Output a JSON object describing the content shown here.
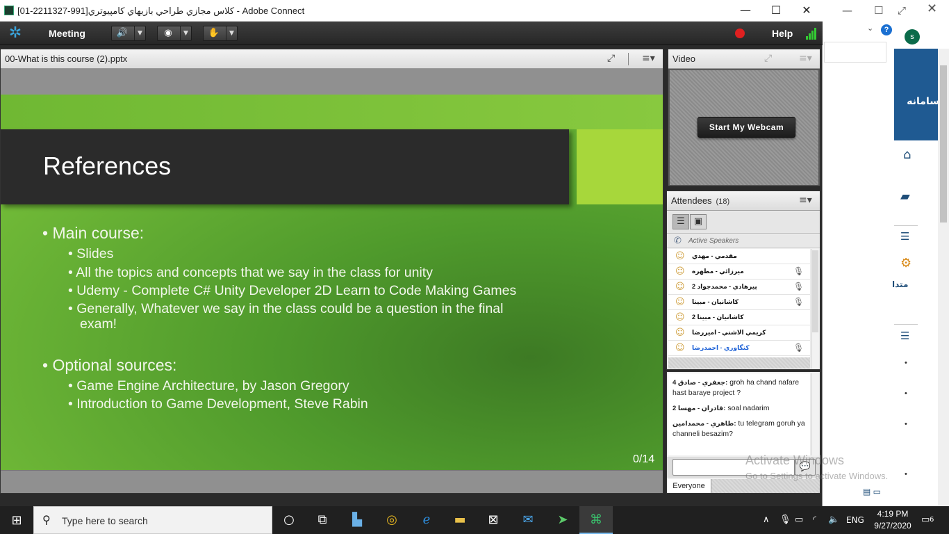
{
  "window": {
    "title": "كلاس مجازي طراحي بازيهاي كامپيوتري[991-2211327-01] - Adobe Connect",
    "min": "—",
    "max": "☐",
    "close": "✕"
  },
  "menubar": {
    "meeting": "Meeting",
    "help": "Help",
    "recording_color": "#e02020"
  },
  "share_pod": {
    "title": "00-What is this course (2).pptx"
  },
  "slide": {
    "title": "References",
    "sections": [
      {
        "heading": "Main course:",
        "items": [
          "Slides",
          "All the topics and concepts that we say in the class for unity",
          "Udemy - Complete C# Unity Developer 2D Learn to Code Making Games",
          "Generally, Whatever we say in the class could be a question in the final exam!"
        ]
      },
      {
        "heading": "Optional sources:",
        "items": [
          "Game Engine Architecture, by Jason Gregory",
          "Introduction to Game Development, Steve Rabin"
        ]
      }
    ],
    "page": "0/14",
    "colors": {
      "title_bg": "#2b2b2b",
      "accent": "#a7d73b",
      "background": "#5ea832"
    }
  },
  "video_pod": {
    "title": "Video",
    "webcam_button": "Start My Webcam"
  },
  "attendees_pod": {
    "title": "Attendees",
    "count": "(18)",
    "active_speakers_label": "Active Speakers",
    "attendees": [
      {
        "name": "مقدمي - مهدي",
        "mic": false,
        "highlight": false
      },
      {
        "name": "ميرزائي - مطهره",
        "mic": true,
        "highlight": false
      },
      {
        "name": "پيرهادي - محمدجواد 2",
        "mic": true,
        "highlight": false
      },
      {
        "name": "كاشانيان - مبينا",
        "mic": true,
        "highlight": false
      },
      {
        "name": "كاشانيان - مبينا 2",
        "mic": false,
        "highlight": false
      },
      {
        "name": "كريمي الاشني - اميررضا",
        "mic": false,
        "highlight": false
      },
      {
        "name": "كنگاوري - احمدرضا",
        "mic": true,
        "highlight": true
      }
    ]
  },
  "chat_pod": {
    "messages": [
      {
        "sender": "جعفري - صادق 4:",
        "text": "groh ha chand nafare hast baraye project ?"
      },
      {
        "sender": "قادران - مهسا 2:",
        "text": "soal nadarim"
      },
      {
        "sender": "طاهري - محمدامين:",
        "text": "tu telegram goruh ya channeli besazim?"
      }
    ],
    "input_value": "",
    "tab": "Everyone"
  },
  "background_window": {
    "profile_initial": "s",
    "help_label": "?",
    "banner_text": "سامانه",
    "menu_label": "متدا"
  },
  "watermark": {
    "line1": "Activate Windows",
    "line2": "Go to Settings to activate Windows."
  },
  "taskbar": {
    "search_placeholder": "Type here to search",
    "language": "ENG",
    "time": "4:19 PM",
    "date": "9/27/2020",
    "notifications": "6"
  }
}
